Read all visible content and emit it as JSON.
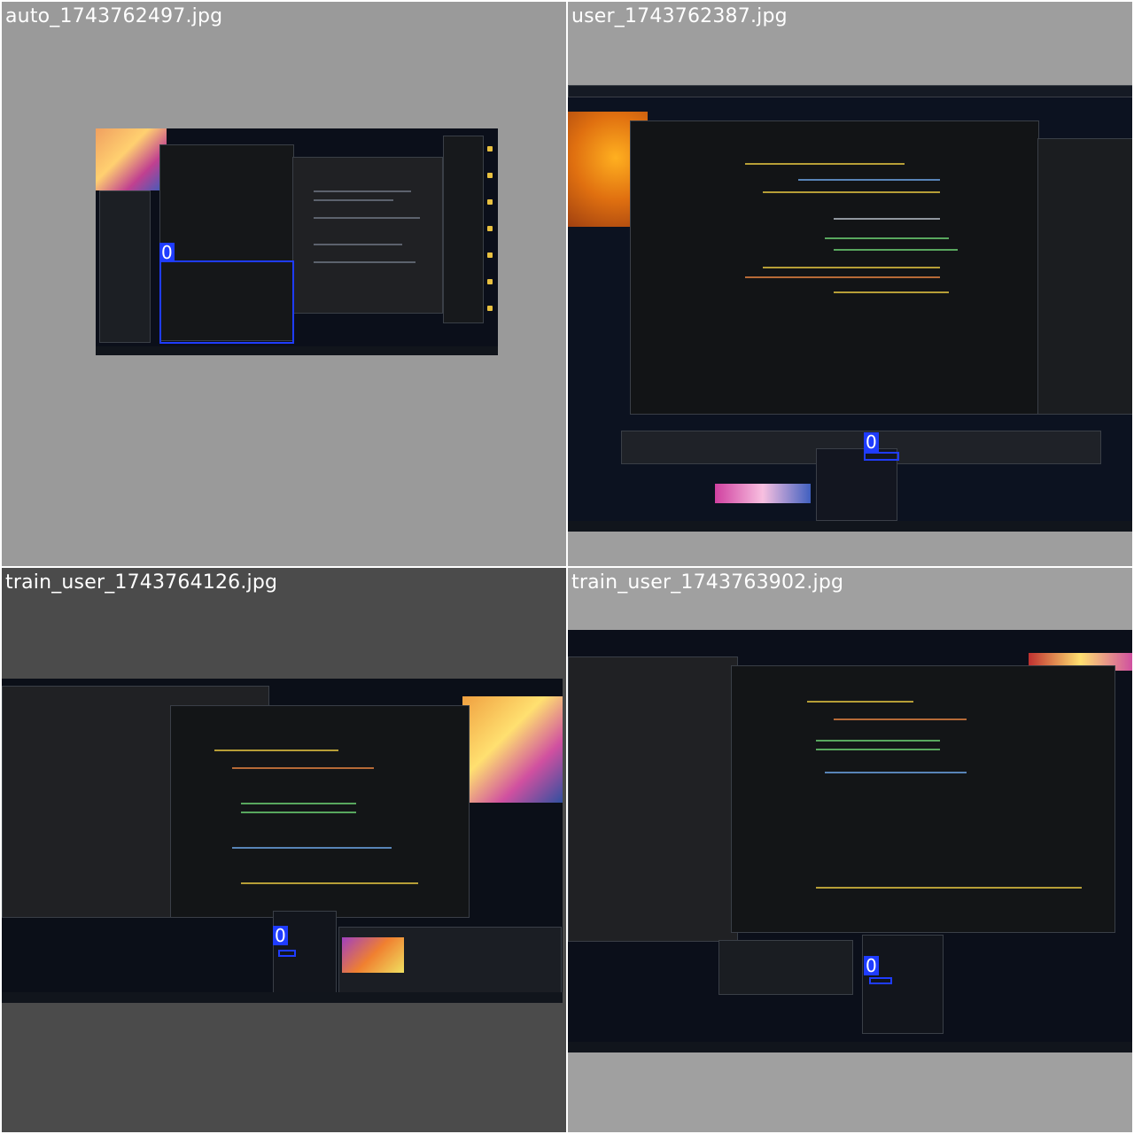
{
  "tiles": [
    {
      "filename": "auto_1743762497.jpg",
      "annotation": {
        "class_label": "0"
      }
    },
    {
      "filename": "user_1743762387.jpg",
      "annotation": {
        "class_label": "0"
      }
    },
    {
      "filename": "train_user_1743764126.jpg",
      "annotation": {
        "class_label": "0"
      }
    },
    {
      "filename": "train_user_1743763902.jpg",
      "annotation": {
        "class_label": "0"
      }
    }
  ],
  "colors": {
    "box": "#1f3cff",
    "label_bg": "#1f3cff",
    "label_text": "#ffffff",
    "desktop_bg": "#0b0f1a",
    "window_bg": "#1c1f24"
  }
}
